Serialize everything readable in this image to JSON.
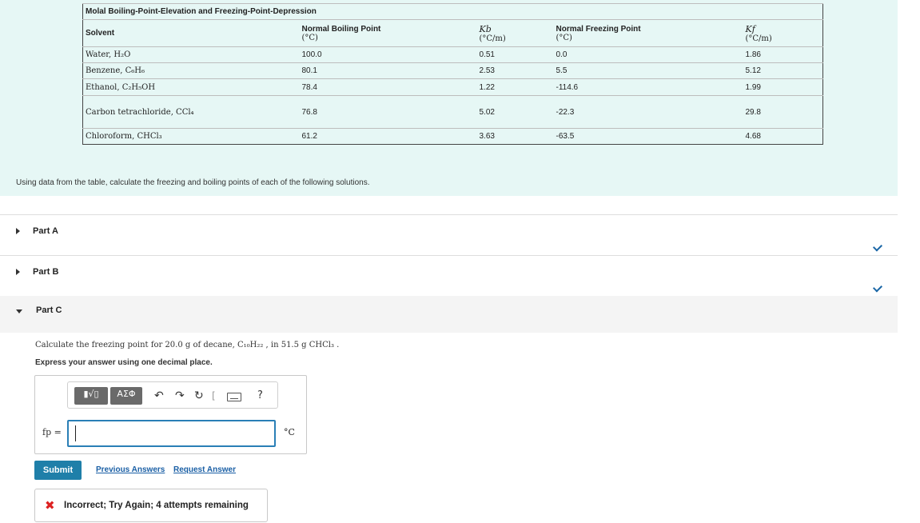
{
  "table": {
    "caption": "Molal Boiling-Point-Elevation and Freezing-Point-Depression",
    "headers": {
      "solvent": "Solvent",
      "bp_title": "Normal Boiling Point",
      "bp_unit": "(°C)",
      "kb_symbol": "Kb",
      "kb_unit": "(°C/m)",
      "fp_title": "Normal Freezing Point",
      "fp_unit": "(°C)",
      "kf_symbol": "Kf",
      "kf_unit": "(°C/m)"
    },
    "rows": [
      {
        "solvent": "Water, H₂O",
        "bp": "100.0",
        "kb": "0.51",
        "fp": "0.0",
        "kf": "1.86"
      },
      {
        "solvent": "Benzene, C₆H₆",
        "bp": "80.1",
        "kb": "2.53",
        "fp": "5.5",
        "kf": "5.12"
      },
      {
        "solvent": "Ethanol, C₂H₅OH",
        "bp": "78.4",
        "kb": "1.22",
        "fp": "-114.6",
        "kf": "1.99"
      },
      {
        "solvent": "Carbon tetrachloride, CCl₄",
        "bp": "76.8",
        "kb": "5.02",
        "fp": "-22.3",
        "kf": "29.8"
      },
      {
        "solvent": "Chloroform, CHCl₃",
        "bp": "61.2",
        "kb": "3.63",
        "fp": "-63.5",
        "kf": "4.68"
      }
    ]
  },
  "prompt": "Using data from the table, calculate the freezing and boiling points of each of the following solutions.",
  "parts": {
    "a_label": "Part A",
    "b_label": "Part B",
    "c_label": "Part C"
  },
  "part_c": {
    "question": "Calculate the freezing point for 20.0 g of decane, C₁₀H₂₂ , in 51.5 g CHCl₃ .",
    "instruction": "Express your answer using one decimal place.",
    "toolbar": {
      "templates_label": "▮√▯",
      "greek_label": "ΑΣΦ",
      "undo_icon": "undo-icon",
      "redo_icon": "redo-icon",
      "reset_icon": "reset-icon",
      "keyboard_icon": "keyboard-icon",
      "help_label": "?"
    },
    "answer_label": "fp =",
    "answer_value": "",
    "unit": "°C",
    "submit_label": "Submit",
    "previous_answers_label": "Previous Answers",
    "request_answer_label": "Request Answer",
    "feedback_icon": "✖",
    "feedback_text": "Incorrect; Try Again; 4 attempts remaining"
  },
  "colors": {
    "panel_bg": "#e6f7f5",
    "accent": "#1f7fa9",
    "check": "#1a66a6",
    "error": "#dd2222"
  }
}
